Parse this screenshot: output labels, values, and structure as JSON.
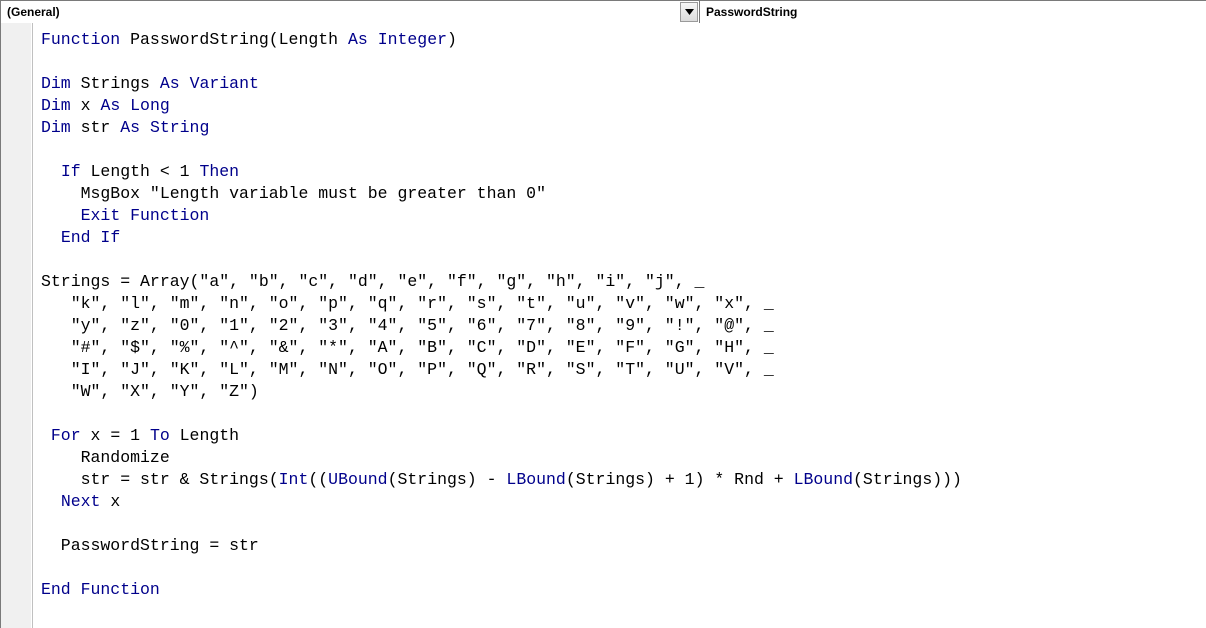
{
  "dropdowns": {
    "object": "(General)",
    "procedure": "PasswordString"
  },
  "code": {
    "tokens": [
      [
        {
          "t": "Function",
          "k": true
        },
        {
          "t": " PasswordString(Length "
        },
        {
          "t": "As",
          "k": true
        },
        {
          "t": " "
        },
        {
          "t": "Integer",
          "k": true
        },
        {
          "t": ")"
        }
      ],
      [],
      [
        {
          "t": "Dim",
          "k": true
        },
        {
          "t": " Strings "
        },
        {
          "t": "As",
          "k": true
        },
        {
          "t": " "
        },
        {
          "t": "Variant",
          "k": true
        }
      ],
      [
        {
          "t": "Dim",
          "k": true
        },
        {
          "t": " x "
        },
        {
          "t": "As",
          "k": true
        },
        {
          "t": " "
        },
        {
          "t": "Long",
          "k": true
        }
      ],
      [
        {
          "t": "Dim",
          "k": true
        },
        {
          "t": " str "
        },
        {
          "t": "As",
          "k": true
        },
        {
          "t": " "
        },
        {
          "t": "String",
          "k": true
        }
      ],
      [],
      [
        {
          "t": "  "
        },
        {
          "t": "If",
          "k": true
        },
        {
          "t": " Length < 1 "
        },
        {
          "t": "Then",
          "k": true
        }
      ],
      [
        {
          "t": "    MsgBox \"Length variable must be greater than 0\""
        }
      ],
      [
        {
          "t": "    "
        },
        {
          "t": "Exit Function",
          "k": true
        }
      ],
      [
        {
          "t": "  "
        },
        {
          "t": "End If",
          "k": true
        }
      ],
      [],
      [
        {
          "t": "Strings = Array(\"a\", \"b\", \"c\", \"d\", \"e\", \"f\", \"g\", \"h\", \"i\", \"j\", _"
        }
      ],
      [
        {
          "t": "   \"k\", \"l\", \"m\", \"n\", \"o\", \"p\", \"q\", \"r\", \"s\", \"t\", \"u\", \"v\", \"w\", \"x\", _"
        }
      ],
      [
        {
          "t": "   \"y\", \"z\", \"0\", \"1\", \"2\", \"3\", \"4\", \"5\", \"6\", \"7\", \"8\", \"9\", \"!\", \"@\", _"
        }
      ],
      [
        {
          "t": "   \"#\", \"$\", \"%\", \"^\", \"&\", \"*\", \"A\", \"B\", \"C\", \"D\", \"E\", \"F\", \"G\", \"H\", _"
        }
      ],
      [
        {
          "t": "   \"I\", \"J\", \"K\", \"L\", \"M\", \"N\", \"O\", \"P\", \"Q\", \"R\", \"S\", \"T\", \"U\", \"V\", _"
        }
      ],
      [
        {
          "t": "   \"W\", \"X\", \"Y\", \"Z\")"
        }
      ],
      [],
      [
        {
          "t": " "
        },
        {
          "t": "For",
          "k": true
        },
        {
          "t": " x = 1 "
        },
        {
          "t": "To",
          "k": true
        },
        {
          "t": " Length"
        }
      ],
      [
        {
          "t": "    Randomize"
        }
      ],
      [
        {
          "t": "    str = str & Strings("
        },
        {
          "t": "Int",
          "k": true
        },
        {
          "t": "(("
        },
        {
          "t": "UBound",
          "k": true
        },
        {
          "t": "(Strings) - "
        },
        {
          "t": "LBound",
          "k": true
        },
        {
          "t": "(Strings) + 1) * Rnd + "
        },
        {
          "t": "LBound",
          "k": true
        },
        {
          "t": "(Strings)))"
        }
      ],
      [
        {
          "t": "  "
        },
        {
          "t": "Next",
          "k": true
        },
        {
          "t": " x"
        }
      ],
      [],
      [
        {
          "t": "  PasswordString = str"
        }
      ],
      [],
      [
        {
          "t": "End Function",
          "k": true
        }
      ]
    ]
  }
}
